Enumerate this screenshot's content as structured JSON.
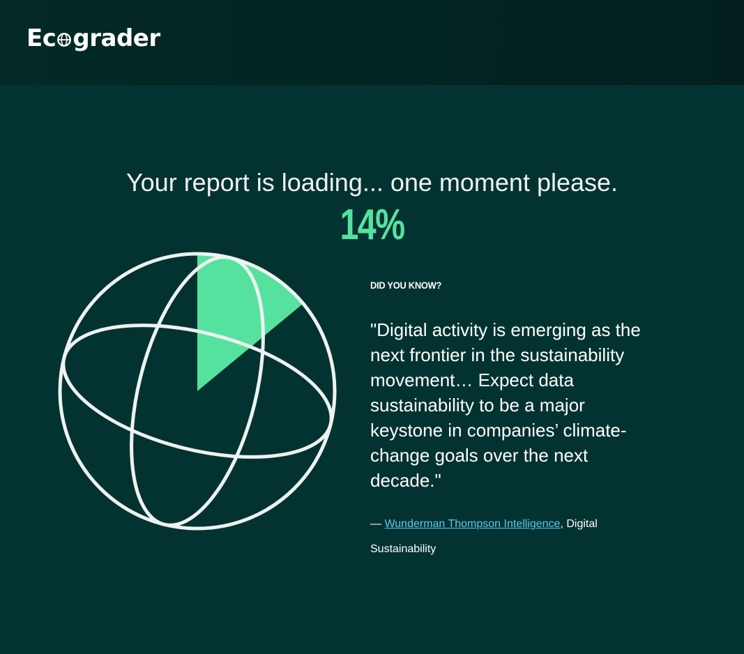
{
  "header": {
    "logo_prefix": "Ec",
    "logo_suffix": "grader",
    "logo_icon": "globe-icon"
  },
  "loading": {
    "message": "Your report is loading... one moment please.",
    "percent_label": "14%",
    "progress": 0.14
  },
  "colors": {
    "background": "#033330",
    "header_background": "#021f1e",
    "accent": "#55e29f",
    "link": "#5ec8f0",
    "text": "#ffffff"
  },
  "fact": {
    "heading": "DID YOU KNOW?",
    "quote": "\"Digital activity is emerging as the next frontier in the sustainability movement… Expect data sustainability to be a major keystone in companies’ climate-change goals over the next decade.\"",
    "attribution_dash": "— ",
    "source_link": "Wunderman Thompson Intelligence",
    "source_rest": ", Digital Sustainability"
  }
}
